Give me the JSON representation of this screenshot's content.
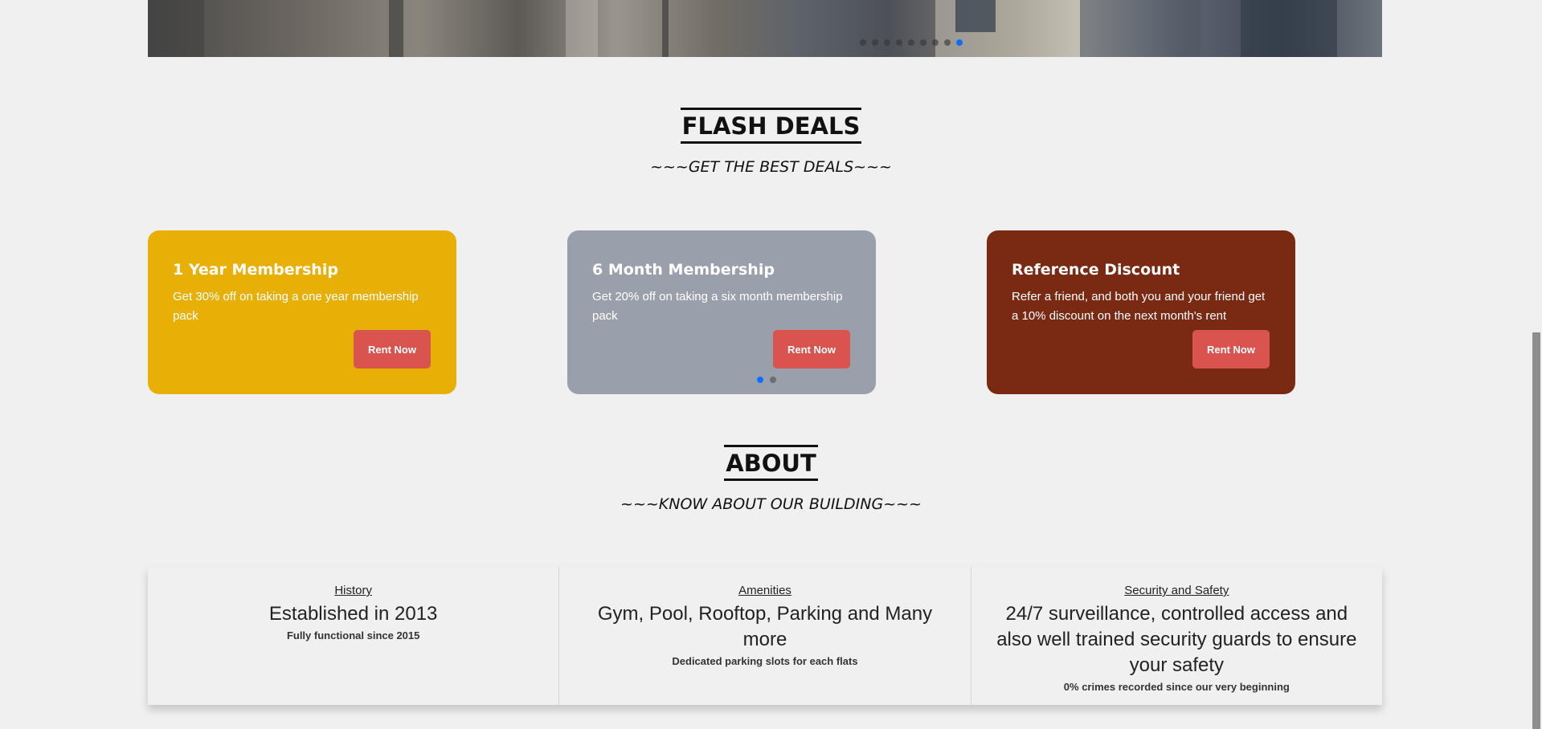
{
  "hero": {
    "slide_count": 9,
    "active_slide": 9
  },
  "flash_deals": {
    "title": "FLASH DEALS",
    "subtitle": "~~~GET THE BEST DEALS~~~",
    "cards": [
      {
        "title": "1 Year Membership",
        "description": "Get 30% off on taking a one year membership pack",
        "button": "Rent Now",
        "color": "#e8b007"
      },
      {
        "title": "6 Month Membership",
        "description": "Get 20% off on taking a six month membership pack",
        "button": "Rent Now",
        "color": "#9aa0ab"
      },
      {
        "title": "Reference Discount",
        "description": "Refer a friend, and both you and your friend get a 10% discount on the next month's rent",
        "button": "Rent Now",
        "color": "#7a2a12"
      }
    ],
    "carousel_pages": 2,
    "carousel_active": 1
  },
  "about": {
    "title": "ABOUT",
    "subtitle": "~~~KNOW ABOUT OUR BUILDING~~~",
    "columns": [
      {
        "label": "History",
        "headline": "Established in 2013",
        "detail": "Fully functional since 2015"
      },
      {
        "label": "Amenities",
        "headline": "Gym, Pool, Rooftop, Parking and Many more",
        "detail": "Dedicated parking slots for each flats"
      },
      {
        "label": "Security and Safety",
        "headline": "24/7 surveillance, controlled access and also well trained security guards to ensure your safety",
        "detail": "0% crimes recorded since our very beginning"
      }
    ]
  },
  "colors": {
    "button": "#d9534f",
    "active_dot": "#0d6efd",
    "background": "#f0f0f0"
  }
}
